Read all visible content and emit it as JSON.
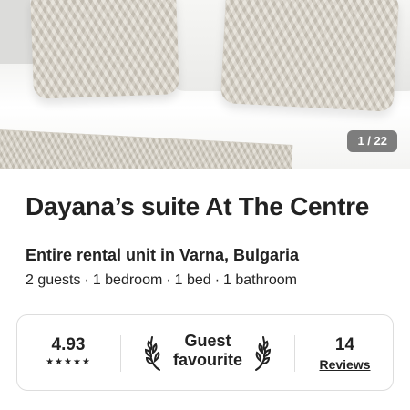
{
  "photo": {
    "counter": "1 / 22"
  },
  "listing": {
    "title": "Dayana’s suite At The Centre",
    "subtitle": "Entire rental unit in Varna, Bulgaria",
    "details": [
      "2 guests",
      "1 bedroom",
      "1 bed",
      "1 bathroom"
    ],
    "separator": "·"
  },
  "stats": {
    "rating": "4.93",
    "stars": "★★★★★",
    "guest_favourite_line1": "Guest",
    "guest_favourite_line2": "favourite",
    "review_count": "14",
    "reviews_label": "Reviews"
  },
  "icons": {
    "laurel_left": "laurel-left-icon",
    "laurel_right": "laurel-right-icon",
    "star": "star-icon"
  },
  "colors": {
    "text": "#222222",
    "border": "#dddddd",
    "counter_bg": "#5a5a5a"
  }
}
